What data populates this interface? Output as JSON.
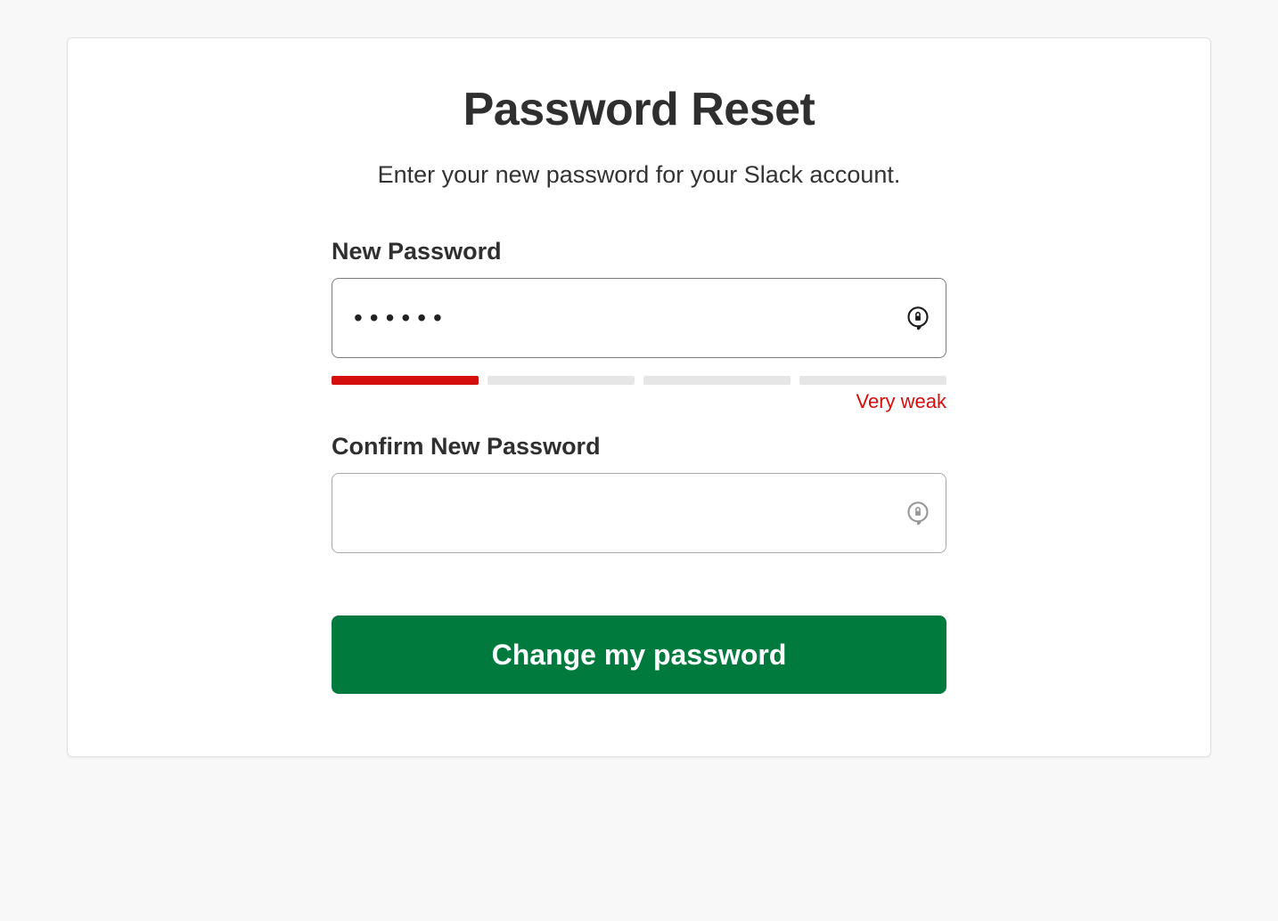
{
  "page": {
    "title": "Password Reset",
    "subtitle": "Enter your new password for your  Slack account."
  },
  "fields": {
    "new_password": {
      "label": "New Password",
      "value": "••••••"
    },
    "confirm_password": {
      "label": "Confirm New Password",
      "value": ""
    }
  },
  "strength": {
    "filled_segments": 1,
    "total_segments": 4,
    "label": "Very weak",
    "color": "#d40e0d"
  },
  "submit": {
    "label": "Change my password"
  }
}
